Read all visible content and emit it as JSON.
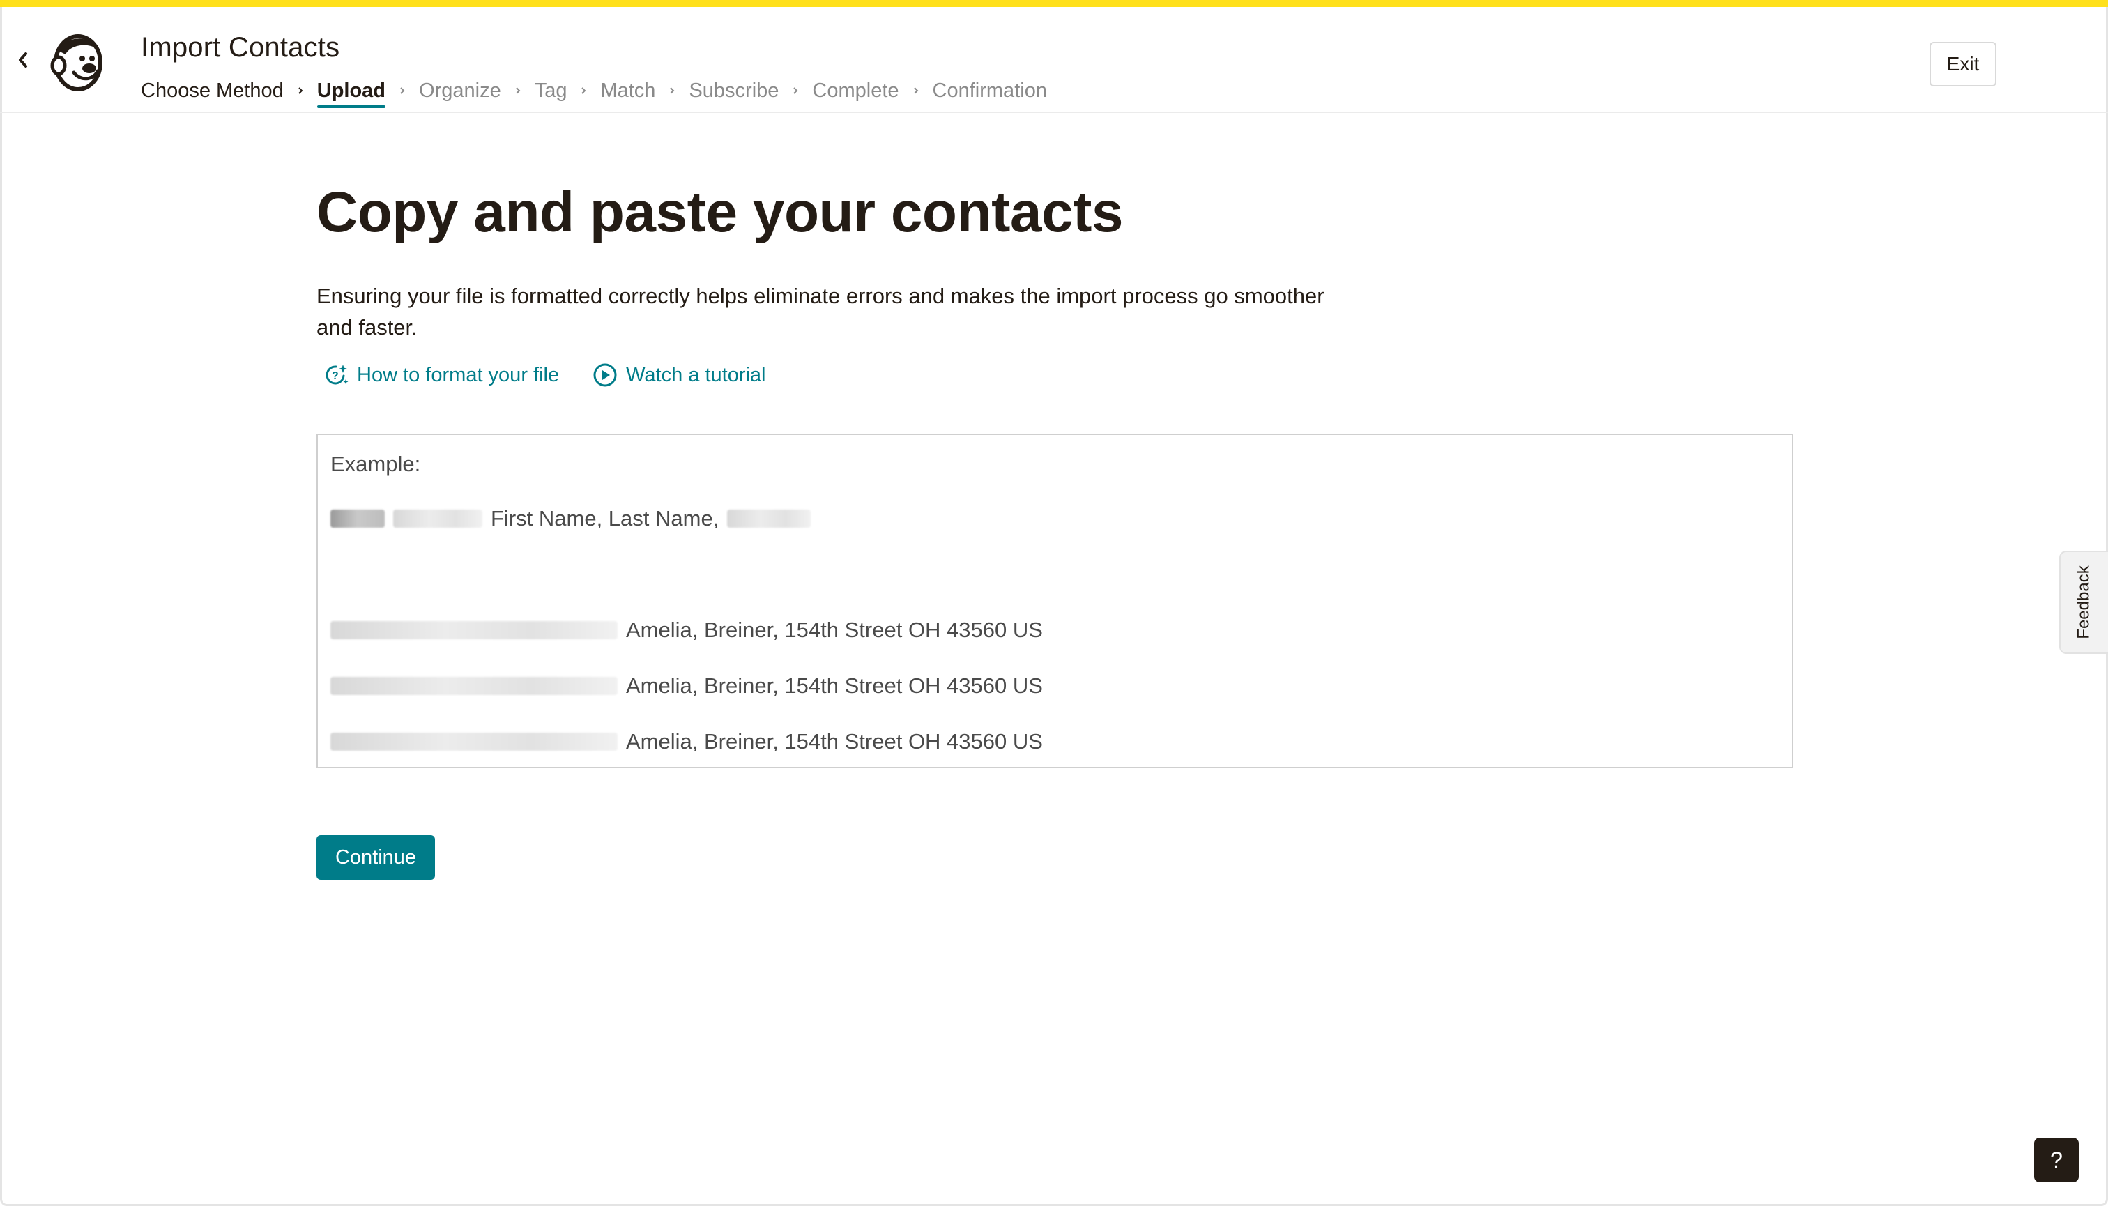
{
  "colors": {
    "accent_yellow": "#ffe01b",
    "teal": "#007c89",
    "text_dark": "#241c15",
    "text_muted": "#8a8a8a"
  },
  "header": {
    "back_icon": "chevron-left-icon",
    "logo_icon": "mailchimp-freddie-logo",
    "title": "Import Contacts",
    "steps": [
      {
        "label": "Choose Method",
        "state": "done"
      },
      {
        "label": "Upload",
        "state": "current"
      },
      {
        "label": "Organize",
        "state": "pending"
      },
      {
        "label": "Tag",
        "state": "pending"
      },
      {
        "label": "Match",
        "state": "pending"
      },
      {
        "label": "Subscribe",
        "state": "pending"
      },
      {
        "label": "Complete",
        "state": "pending"
      },
      {
        "label": "Confirmation",
        "state": "pending"
      }
    ],
    "exit_label": "Exit"
  },
  "main": {
    "heading": "Copy and paste your contacts",
    "intro": "Ensuring your file is formatted correctly helps eliminate errors and makes the import process go smoother and faster.",
    "links": [
      {
        "label": "How to format your file",
        "icon": "help-sparkle-icon"
      },
      {
        "label": "Watch a tutorial",
        "icon": "play-circle-icon"
      }
    ],
    "example": {
      "label": "Example:",
      "header_text": "First Name, Last Name,",
      "rows": [
        "Amelia, Breiner, 154th Street OH 43560 US",
        "Amelia, Breiner, 154th Street OH 43560 US",
        "Amelia, Breiner, 154th Street OH 43560 US"
      ]
    },
    "continue_label": "Continue"
  },
  "side": {
    "feedback_label": "Feedback",
    "help_label": "?"
  }
}
